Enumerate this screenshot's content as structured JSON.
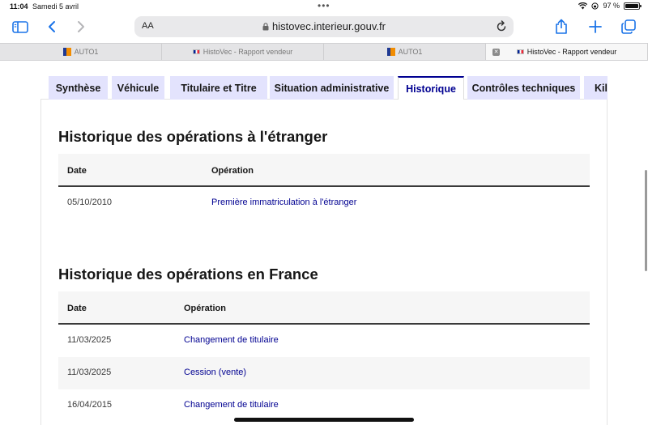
{
  "status": {
    "time": "11:04",
    "date": "Samedi 5 avril",
    "battery": "97 %",
    "battery_level": 0.97
  },
  "browser": {
    "text_size_label": "AA",
    "url": "histovec.interieur.gouv.fr",
    "tabs": [
      {
        "title": "AUTO1",
        "favicon": "auto1-favicon"
      },
      {
        "title": "HistoVec - Rapport vendeur",
        "favicon": "france-flag-favicon"
      },
      {
        "title": "AUTO1",
        "favicon": "auto1-favicon"
      },
      {
        "title": "HistoVec - Rapport vendeur",
        "favicon": "france-flag-favicon",
        "active": true
      }
    ]
  },
  "page_tabs": [
    "Synthèse",
    "Véhicule",
    "Titulaire et Titre",
    "Situation administrative",
    "Historique",
    "Contrôles techniques",
    "Kilo"
  ],
  "selected_tab": "Historique",
  "foreign": {
    "title": "Historique des opérations à l'étranger",
    "col_date": "Date",
    "col_operation": "Opération",
    "rows": [
      {
        "date": "05/10/2010",
        "operation": "Première immatriculation à l'étranger"
      }
    ]
  },
  "france": {
    "title": "Historique des opérations en France",
    "col_date": "Date",
    "col_operation": "Opération",
    "rows": [
      {
        "date": "11/03/2025",
        "operation": "Changement de titulaire"
      },
      {
        "date": "11/03/2025",
        "operation": "Cession (vente)"
      },
      {
        "date": "16/04/2015",
        "operation": "Changement de titulaire"
      }
    ]
  },
  "colors": {
    "primary": "#000091",
    "tab_bg": "#e3e3fd",
    "safari_blue": "#1a73e8"
  }
}
